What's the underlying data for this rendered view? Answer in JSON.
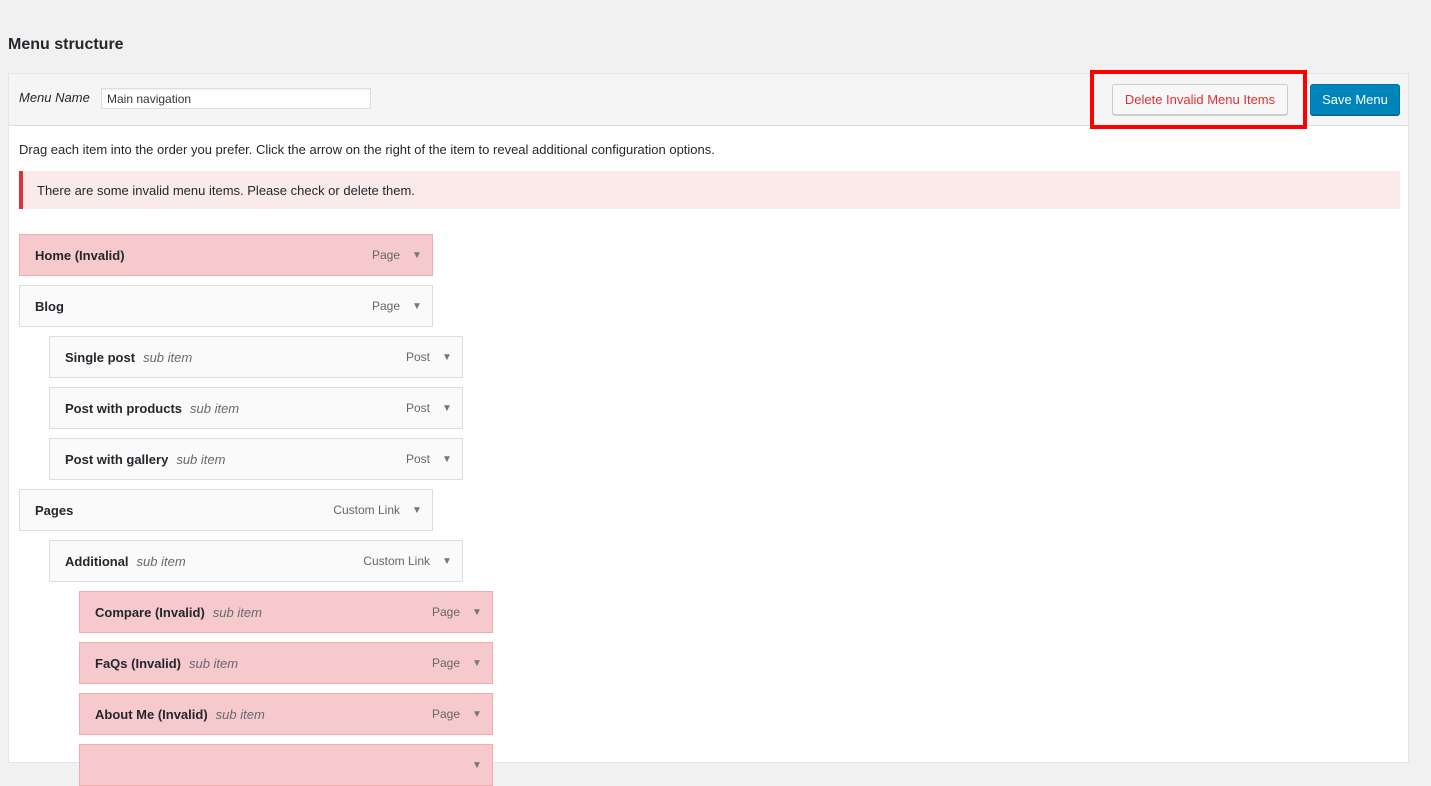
{
  "page": {
    "heading": "Menu structure"
  },
  "header": {
    "menu_name_label": "Menu Name",
    "menu_name_value": "Main navigation",
    "delete_label": "Delete Invalid Menu Items",
    "save_label": "Save Menu"
  },
  "instructions": "Drag each item into the order you prefer. Click the arrow on the right of the item to reveal additional configuration options.",
  "notice": "There are some invalid menu items. Please check or delete them.",
  "items": [
    {
      "title": "Home (Invalid)",
      "sub": "",
      "type": "Page",
      "depth": 0,
      "invalid": true
    },
    {
      "title": "Blog",
      "sub": "",
      "type": "Page",
      "depth": 0,
      "invalid": false
    },
    {
      "title": "Single post",
      "sub": "sub item",
      "type": "Post",
      "depth": 1,
      "invalid": false
    },
    {
      "title": "Post with products",
      "sub": "sub item",
      "type": "Post",
      "depth": 1,
      "invalid": false
    },
    {
      "title": "Post with gallery",
      "sub": "sub item",
      "type": "Post",
      "depth": 1,
      "invalid": false
    },
    {
      "title": "Pages",
      "sub": "",
      "type": "Custom Link",
      "depth": 0,
      "invalid": false
    },
    {
      "title": "Additional",
      "sub": "sub item",
      "type": "Custom Link",
      "depth": 1,
      "invalid": false
    },
    {
      "title": "Compare (Invalid)",
      "sub": "sub item",
      "type": "Page",
      "depth": 2,
      "invalid": true
    },
    {
      "title": "FaQs (Invalid)",
      "sub": "sub item",
      "type": "Page",
      "depth": 2,
      "invalid": true
    },
    {
      "title": "About Me (Invalid)",
      "sub": "sub item",
      "type": "Page",
      "depth": 2,
      "invalid": true
    },
    {
      "title": "",
      "sub": "",
      "type": "",
      "depth": 2,
      "invalid": true
    }
  ],
  "icons": {
    "toggle": "arrow-down-icon"
  },
  "colors": {
    "invalid_bg": "#f6c9cc",
    "primary": "#0085ba",
    "error": "#dc3232",
    "highlight": "#ff0000"
  }
}
